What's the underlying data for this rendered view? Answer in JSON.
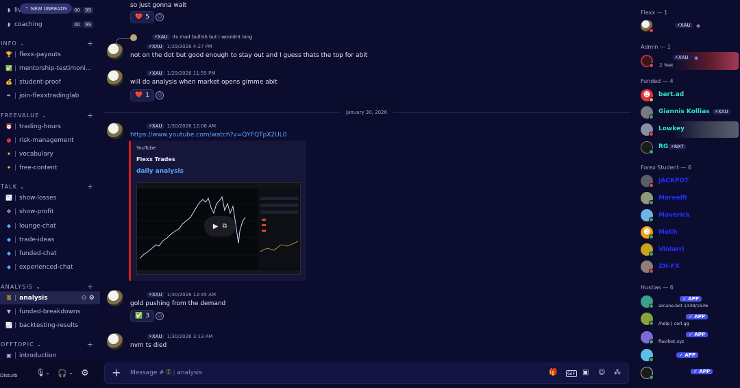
{
  "sidebar": {
    "new_unreads": "NEW UNREADS",
    "top_items": [
      {
        "icon": "speaker-icon",
        "label": "live",
        "counts": [
          "00",
          "99"
        ]
      },
      {
        "icon": "speaker-icon",
        "label": "coaching",
        "counts": [
          "00",
          "99"
        ]
      }
    ],
    "categories": [
      {
        "label": "INFO",
        "channels": [
          {
            "icon": "trophy-icon",
            "label": "flexx-payouts"
          },
          {
            "icon": "check-icon",
            "label": "mentorship-testimoni..."
          },
          {
            "icon": "moneybag-icon",
            "label": "student-proof"
          },
          {
            "icon": "pen-icon",
            "label": "join-flexxtradinglab"
          }
        ]
      },
      {
        "label": "FREEVALUE",
        "channels": [
          {
            "icon": "alarm-icon",
            "label": "trading-hours"
          },
          {
            "icon": "drop-icon",
            "label": "risk-management"
          },
          {
            "icon": "dizzy-icon",
            "label": "vocabulary"
          },
          {
            "icon": "dizzy-icon",
            "label": "free-content"
          }
        ]
      },
      {
        "label": "TALK",
        "channels": [
          {
            "icon": "chart-icon",
            "label": "show-losses"
          },
          {
            "icon": "paw-icon",
            "label": "show-profit"
          },
          {
            "icon": "gem-icon",
            "label": "lounge-chat"
          },
          {
            "icon": "gem-icon",
            "label": "trade-ideas"
          },
          {
            "icon": "gem-icon",
            "label": "funded-chat"
          },
          {
            "icon": "gem-icon",
            "label": "experienced-chat"
          }
        ]
      },
      {
        "label": "ANALYSIS",
        "channels": [
          {
            "icon": "key-icon",
            "label": "analysis",
            "active": true
          },
          {
            "icon": "wolf-icon",
            "label": "funded-breakdowns"
          },
          {
            "icon": "chart-icon",
            "label": "backtesting-results"
          }
        ]
      },
      {
        "label": "OFFTOPIC",
        "channels": [
          {
            "icon": "tv-icon",
            "label": "introduction"
          }
        ]
      }
    ],
    "user_status": "Disturb"
  },
  "chat": {
    "messages": [
      {
        "id": "m0",
        "tag": "",
        "time": "",
        "text": "so just gonna wait",
        "reaction": {
          "emoji": "❤️",
          "count": "5"
        }
      },
      {
        "id": "m1",
        "reply_tag": "XAU",
        "reply_text": "its mad bullish but i wouldnt long",
        "tag": "XAU",
        "time": "1/29/2026 4:27 PM",
        "text": "not on the dot but good enough to stay out and I guess thats the top for abit"
      },
      {
        "id": "m2",
        "tag": "XAU",
        "time": "1/29/2026 11:55 PM",
        "text": "will do analysis when market opens gimme abit",
        "reaction": {
          "emoji": "❤️",
          "count": "1"
        }
      },
      {
        "id": "m3",
        "tag": "XAU",
        "time": "1/30/2026 12:08 AM",
        "link": "https://www.youtube.com/watch?v=QYFQTpX2UL0"
      },
      {
        "id": "m4",
        "tag": "XAU",
        "time": "1/30/2026 12:45 AM",
        "text": "gold pushing from the demand",
        "reaction": {
          "emoji": "✅",
          "count": "3"
        }
      },
      {
        "id": "m5",
        "tag": "XAU",
        "time": "1/30/2026 3:13 AM",
        "text": "nvm ts died"
      }
    ],
    "date_divider": "January 30, 2026",
    "embed": {
      "provider": "YouTube",
      "author": "Flexx Trades",
      "title": "daily analysis"
    }
  },
  "composer": {
    "placeholder_prefix": "Message #",
    "channel_name": "analysis"
  },
  "members": {
    "groups": [
      {
        "label": "Flexx — 1",
        "members": [
          {
            "name": "",
            "tag": "XAU",
            "color": "#ffffff"
          }
        ]
      },
      {
        "label": "Admin — 1",
        "members": [
          {
            "name": "",
            "tag": "XAU",
            "sub": "Yeat",
            "color": "#ffffff"
          }
        ]
      },
      {
        "label": "Funded — 4",
        "members": [
          {
            "name": "bart.ad",
            "color": "#2ee6c6"
          },
          {
            "name": "Giannis Kollias",
            "tag": "XAU",
            "color": "#2ee6c6"
          },
          {
            "name": "Lowkey",
            "color": "#2ee6c6"
          },
          {
            "name": "RG",
            "tag": "NXT",
            "color": "#2ee6c6"
          }
        ]
      },
      {
        "label": "Forex Student — 6",
        "members": [
          {
            "name": "JACKPOT",
            "color": "#2430ff"
          },
          {
            "name": "Mareelfi",
            "color": "#2430ff"
          },
          {
            "name": "Maverick",
            "color": "#2430ff"
          },
          {
            "name": "Melih",
            "color": "#2430ff"
          },
          {
            "name": "Vinlarri",
            "color": "#2430ff"
          },
          {
            "name": "ZH-FX",
            "color": "#2430ff"
          }
        ]
      },
      {
        "label": "Hustlas — 6",
        "members": [
          {
            "name": "",
            "app": "APP",
            "sub": "arcane.bot 1339/1536"
          },
          {
            "name": "",
            "app": "APP",
            "sub": "/help | carl.gg"
          },
          {
            "name": "",
            "app": "APP",
            "sub": "flavibot.xyz"
          },
          {
            "name": "",
            "app": "APP",
            "sub": ""
          },
          {
            "name": "",
            "app": "APP",
            "sub": ""
          }
        ]
      }
    ]
  },
  "colors": {
    "background": "#0b0b2c",
    "accent_link": "#5aa6ff",
    "funded": "#2ee6c6",
    "student": "#2430ff",
    "embed_bar": "#e01e1e"
  }
}
